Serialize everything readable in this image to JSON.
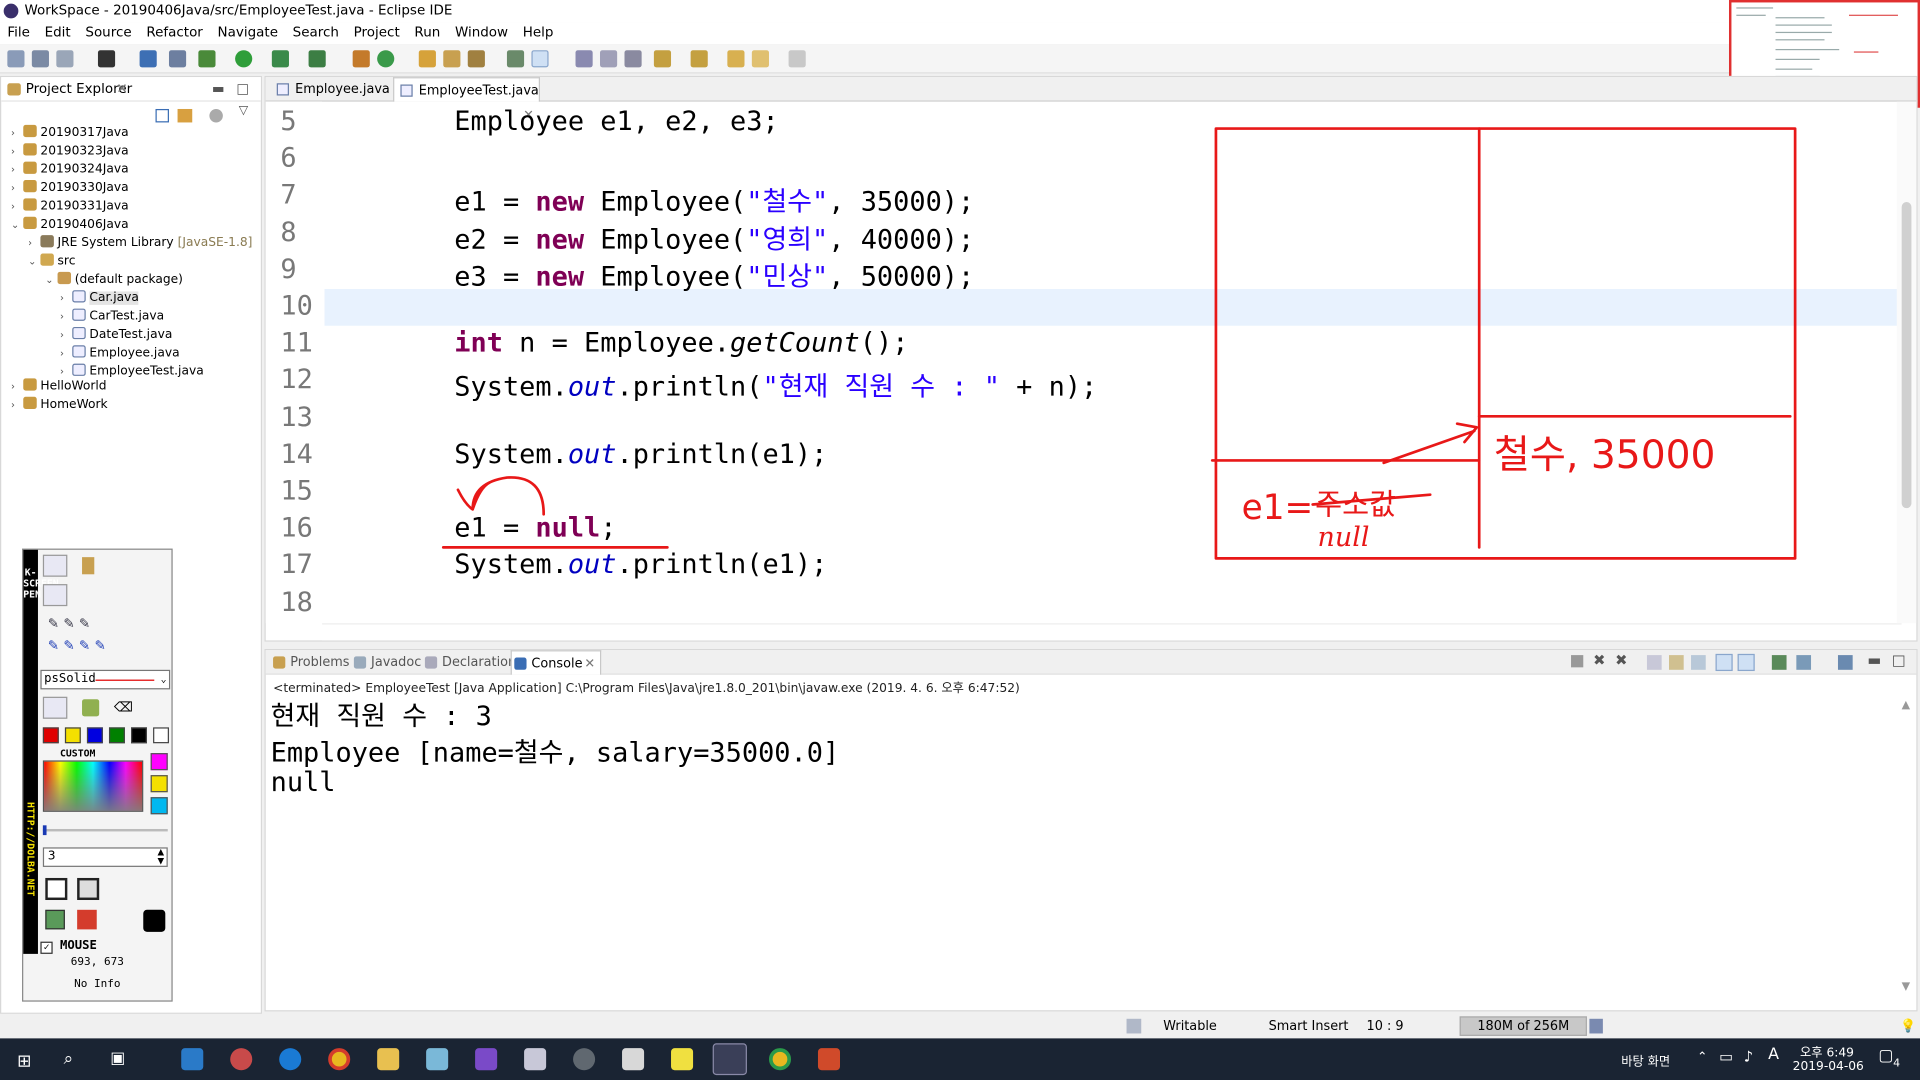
{
  "window": {
    "title": "WorkSpace - 20190406Java/src/EmployeeTest.java - Eclipse IDE"
  },
  "menu": [
    "File",
    "Edit",
    "Source",
    "Refactor",
    "Navigate",
    "Search",
    "Project",
    "Run",
    "Window",
    "Help"
  ],
  "explorer": {
    "title": "Project Explorer",
    "items": [
      {
        "label": "20190317Java"
      },
      {
        "label": "20190323Java"
      },
      {
        "label": "20190324Java"
      },
      {
        "label": "20190330Java"
      },
      {
        "label": "20190331Java"
      },
      {
        "label": "20190406Java"
      },
      {
        "label": "JRE System Library",
        "suffix": "[JavaSE-1.8]"
      },
      {
        "label": "src"
      },
      {
        "label": "(default package)"
      },
      {
        "label": "Car.java"
      },
      {
        "label": "CarTest.java"
      },
      {
        "label": "DateTest.java"
      },
      {
        "label": "Employee.java"
      },
      {
        "label": "EmployeeTest.java"
      },
      {
        "label": "HelloWorld"
      },
      {
        "label": "HomeWork"
      }
    ]
  },
  "editor": {
    "tabs": [
      {
        "label": "Employee.java"
      },
      {
        "label": "EmployeeTest.java"
      }
    ],
    "lines": [
      {
        "num": "5",
        "segments": [
          {
            "t": "Employee e1, e2, e3;",
            "c": ""
          }
        ]
      },
      {
        "num": "6",
        "segments": []
      },
      {
        "num": "7",
        "segments": [
          {
            "t": "e1 = ",
            "c": ""
          },
          {
            "t": "new",
            "c": "kw"
          },
          {
            "t": " Employee(",
            "c": ""
          },
          {
            "t": "\"철수\"",
            "c": "str"
          },
          {
            "t": ", 35000);",
            "c": ""
          }
        ]
      },
      {
        "num": "8",
        "segments": [
          {
            "t": "e2 = ",
            "c": ""
          },
          {
            "t": "new",
            "c": "kw"
          },
          {
            "t": " Employee(",
            "c": ""
          },
          {
            "t": "\"영희\"",
            "c": "str"
          },
          {
            "t": ", 40000);",
            "c": ""
          }
        ]
      },
      {
        "num": "9",
        "segments": [
          {
            "t": "e3 = ",
            "c": ""
          },
          {
            "t": "new",
            "c": "kw"
          },
          {
            "t": " Employee(",
            "c": ""
          },
          {
            "t": "\"민상\"",
            "c": "str"
          },
          {
            "t": ", 50000);",
            "c": ""
          }
        ]
      },
      {
        "num": "10",
        "segments": []
      },
      {
        "num": "11",
        "segments": [
          {
            "t": "int",
            "c": "kw"
          },
          {
            "t": " n = Employee.",
            "c": ""
          },
          {
            "t": "getCount",
            "c": "mth"
          },
          {
            "t": "();",
            "c": ""
          }
        ]
      },
      {
        "num": "12",
        "segments": [
          {
            "t": "System.",
            "c": ""
          },
          {
            "t": "out",
            "c": "fld"
          },
          {
            "t": ".println(",
            "c": ""
          },
          {
            "t": "\"현재 직원 수 : \"",
            "c": "str"
          },
          {
            "t": " + n);",
            "c": ""
          }
        ]
      },
      {
        "num": "13",
        "segments": []
      },
      {
        "num": "14",
        "segments": [
          {
            "t": "System.",
            "c": ""
          },
          {
            "t": "out",
            "c": "fld"
          },
          {
            "t": ".println(e1);",
            "c": ""
          }
        ]
      },
      {
        "num": "15",
        "segments": []
      },
      {
        "num": "16",
        "segments": [
          {
            "t": "e1 = ",
            "c": ""
          },
          {
            "t": "null",
            "c": "kw"
          },
          {
            "t": ";",
            "c": ""
          }
        ]
      },
      {
        "num": "17",
        "segments": [
          {
            "t": "System.",
            "c": ""
          },
          {
            "t": "out",
            "c": "fld"
          },
          {
            "t": ".println(e1);",
            "c": ""
          }
        ]
      },
      {
        "num": "18",
        "segments": []
      }
    ]
  },
  "annotation": {
    "heap_text": "철수, 35000",
    "ref_label": "e1=",
    "struck_text": "주소값",
    "null_text": "null"
  },
  "console": {
    "tabs": [
      {
        "label": "Problems"
      },
      {
        "label": "Javadoc"
      },
      {
        "label": "Declaration"
      },
      {
        "label": "Console"
      }
    ],
    "process": "<terminated> EmployeeTest [Java Application] C:\\Program Files\\Java\\jre1.8.0_201\\bin\\javaw.exe (2019. 4. 6. 오후 6:47:52)",
    "output": [
      "현재 직원 수 : 3",
      "Employee [name=철수, salary=35000.0]",
      "null"
    ]
  },
  "status": {
    "mode": "Writable",
    "insert": "Smart Insert",
    "position": "10 : 9",
    "heap": "180M of 256M"
  },
  "pen_tool": {
    "style": "psSolid",
    "custom_label": "CUSTOM",
    "width": "3",
    "mouse_label": "MOUSE",
    "coords": "693, 673",
    "info": "No Info",
    "side_text_top": "K-SCREEN PEN",
    "side_text_url": "HTTP://DOLBA.NET",
    "colors": [
      "#e00000",
      "#f4e000",
      "#0000e0",
      "#008000",
      "#000000",
      "#ffffff"
    ]
  },
  "taskbar": {
    "desktop": "바탕 화면",
    "time": "오후 6:49",
    "date": "2019-04-06",
    "ime": "A",
    "notif_count": "4"
  }
}
